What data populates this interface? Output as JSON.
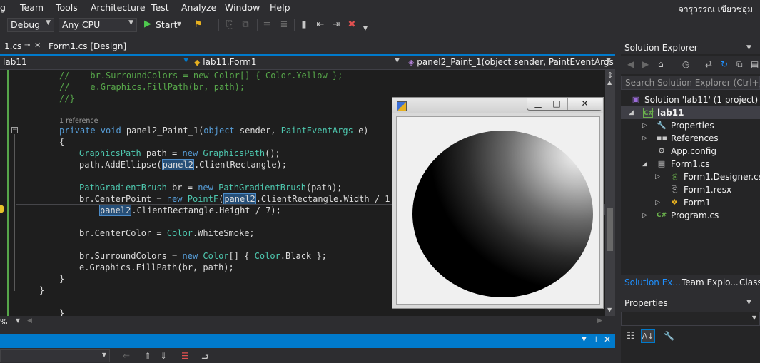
{
  "menu": {
    "items": [
      "g",
      "Team",
      "Tools",
      "Architecture",
      "Test",
      "Analyze",
      "Window",
      "Help"
    ],
    "user": "จารุวรรณ เขียวชอุ่ม"
  },
  "toolbar": {
    "config": "Debug",
    "platform": "Any CPU",
    "start": "Start"
  },
  "tabs": {
    "active": "1.cs",
    "other": "Form1.cs [Design]"
  },
  "navbar": {
    "project": "lab11",
    "class": "lab11.Form1",
    "member": "panel2_Paint_1(object sender, PaintEventArgs e)"
  },
  "code": {
    "l1_comment": "//    br.SurroundColors = new Color[] { Color.Yellow };",
    "l2_comment": "//    e.Graphics.FillPath(br, path);",
    "l3_comment": "//}",
    "ref": "1 reference",
    "sig_kw1": "private void ",
    "sig_name": "panel2_Paint_1(",
    "sig_kw2": "object",
    "sig_mid": " sender, ",
    "sig_type": "PaintEventArgs",
    "sig_end": " e)",
    "brace_open": "{",
    "gp_type": "GraphicsPath",
    "gp_mid": " path = ",
    "gp_new": "new",
    "gp_type2": " GraphicsPath",
    "gp_end": "();",
    "ae_start": "path.AddEllipse(",
    "ae_hl": "panel2",
    "ae_end": ".ClientRectangle);",
    "pgb_type": "PathGradientBrush",
    "pgb_mid": " br = ",
    "pgb_new": "new",
    "pgb_type2": " PathGradientBrush",
    "pgb_end": "(path);",
    "cp_start": "br.CenterPoint = ",
    "cp_new": "new",
    "cp_type": " PointF",
    "cp_paren": "(",
    "cp_hl": "panel2",
    "cp_end": ".ClientRectangle.Width / 1,",
    "cp2_hl": "panel2",
    "cp2_end": ".ClientRectangle.Height / 7);",
    "cc_start": "br.CenterColor = ",
    "cc_type": "Color",
    "cc_end": ".WhiteSmoke;",
    "sc_start": "br.SurroundColors = ",
    "sc_new": "new",
    "sc_type": " Color",
    "sc_mid": "[] { ",
    "sc_type2": "Color",
    "sc_end": ".Black };",
    "fp": "e.Graphics.FillPath(br, path);",
    "brace_close_inner": "}",
    "brace_close_outer": "}",
    "brace_close_last": "}"
  },
  "zoom": "%",
  "solution_explorer": {
    "title": "Solution Explorer",
    "search_placeholder": "Search Solution Explorer (Ctrl+;)",
    "items": [
      {
        "label": "Solution 'lab11' (1 project)"
      },
      {
        "label": "lab11"
      },
      {
        "label": "Properties"
      },
      {
        "label": "References"
      },
      {
        "label": "App.config"
      },
      {
        "label": "Form1.cs"
      },
      {
        "label": "Form1.Designer.cs"
      },
      {
        "label": "Form1.resx"
      },
      {
        "label": "Form1"
      },
      {
        "label": "Program.cs"
      }
    ],
    "tabs": [
      "Solution Ex...",
      "Team Explo...",
      "Class"
    ]
  },
  "properties": {
    "title": "Properties"
  },
  "colors": {
    "accent": "#007acc",
    "editor_bg": "#1e1e1e",
    "comment": "#57a64a",
    "keyword": "#569cd6",
    "type": "#4ec9b0"
  }
}
